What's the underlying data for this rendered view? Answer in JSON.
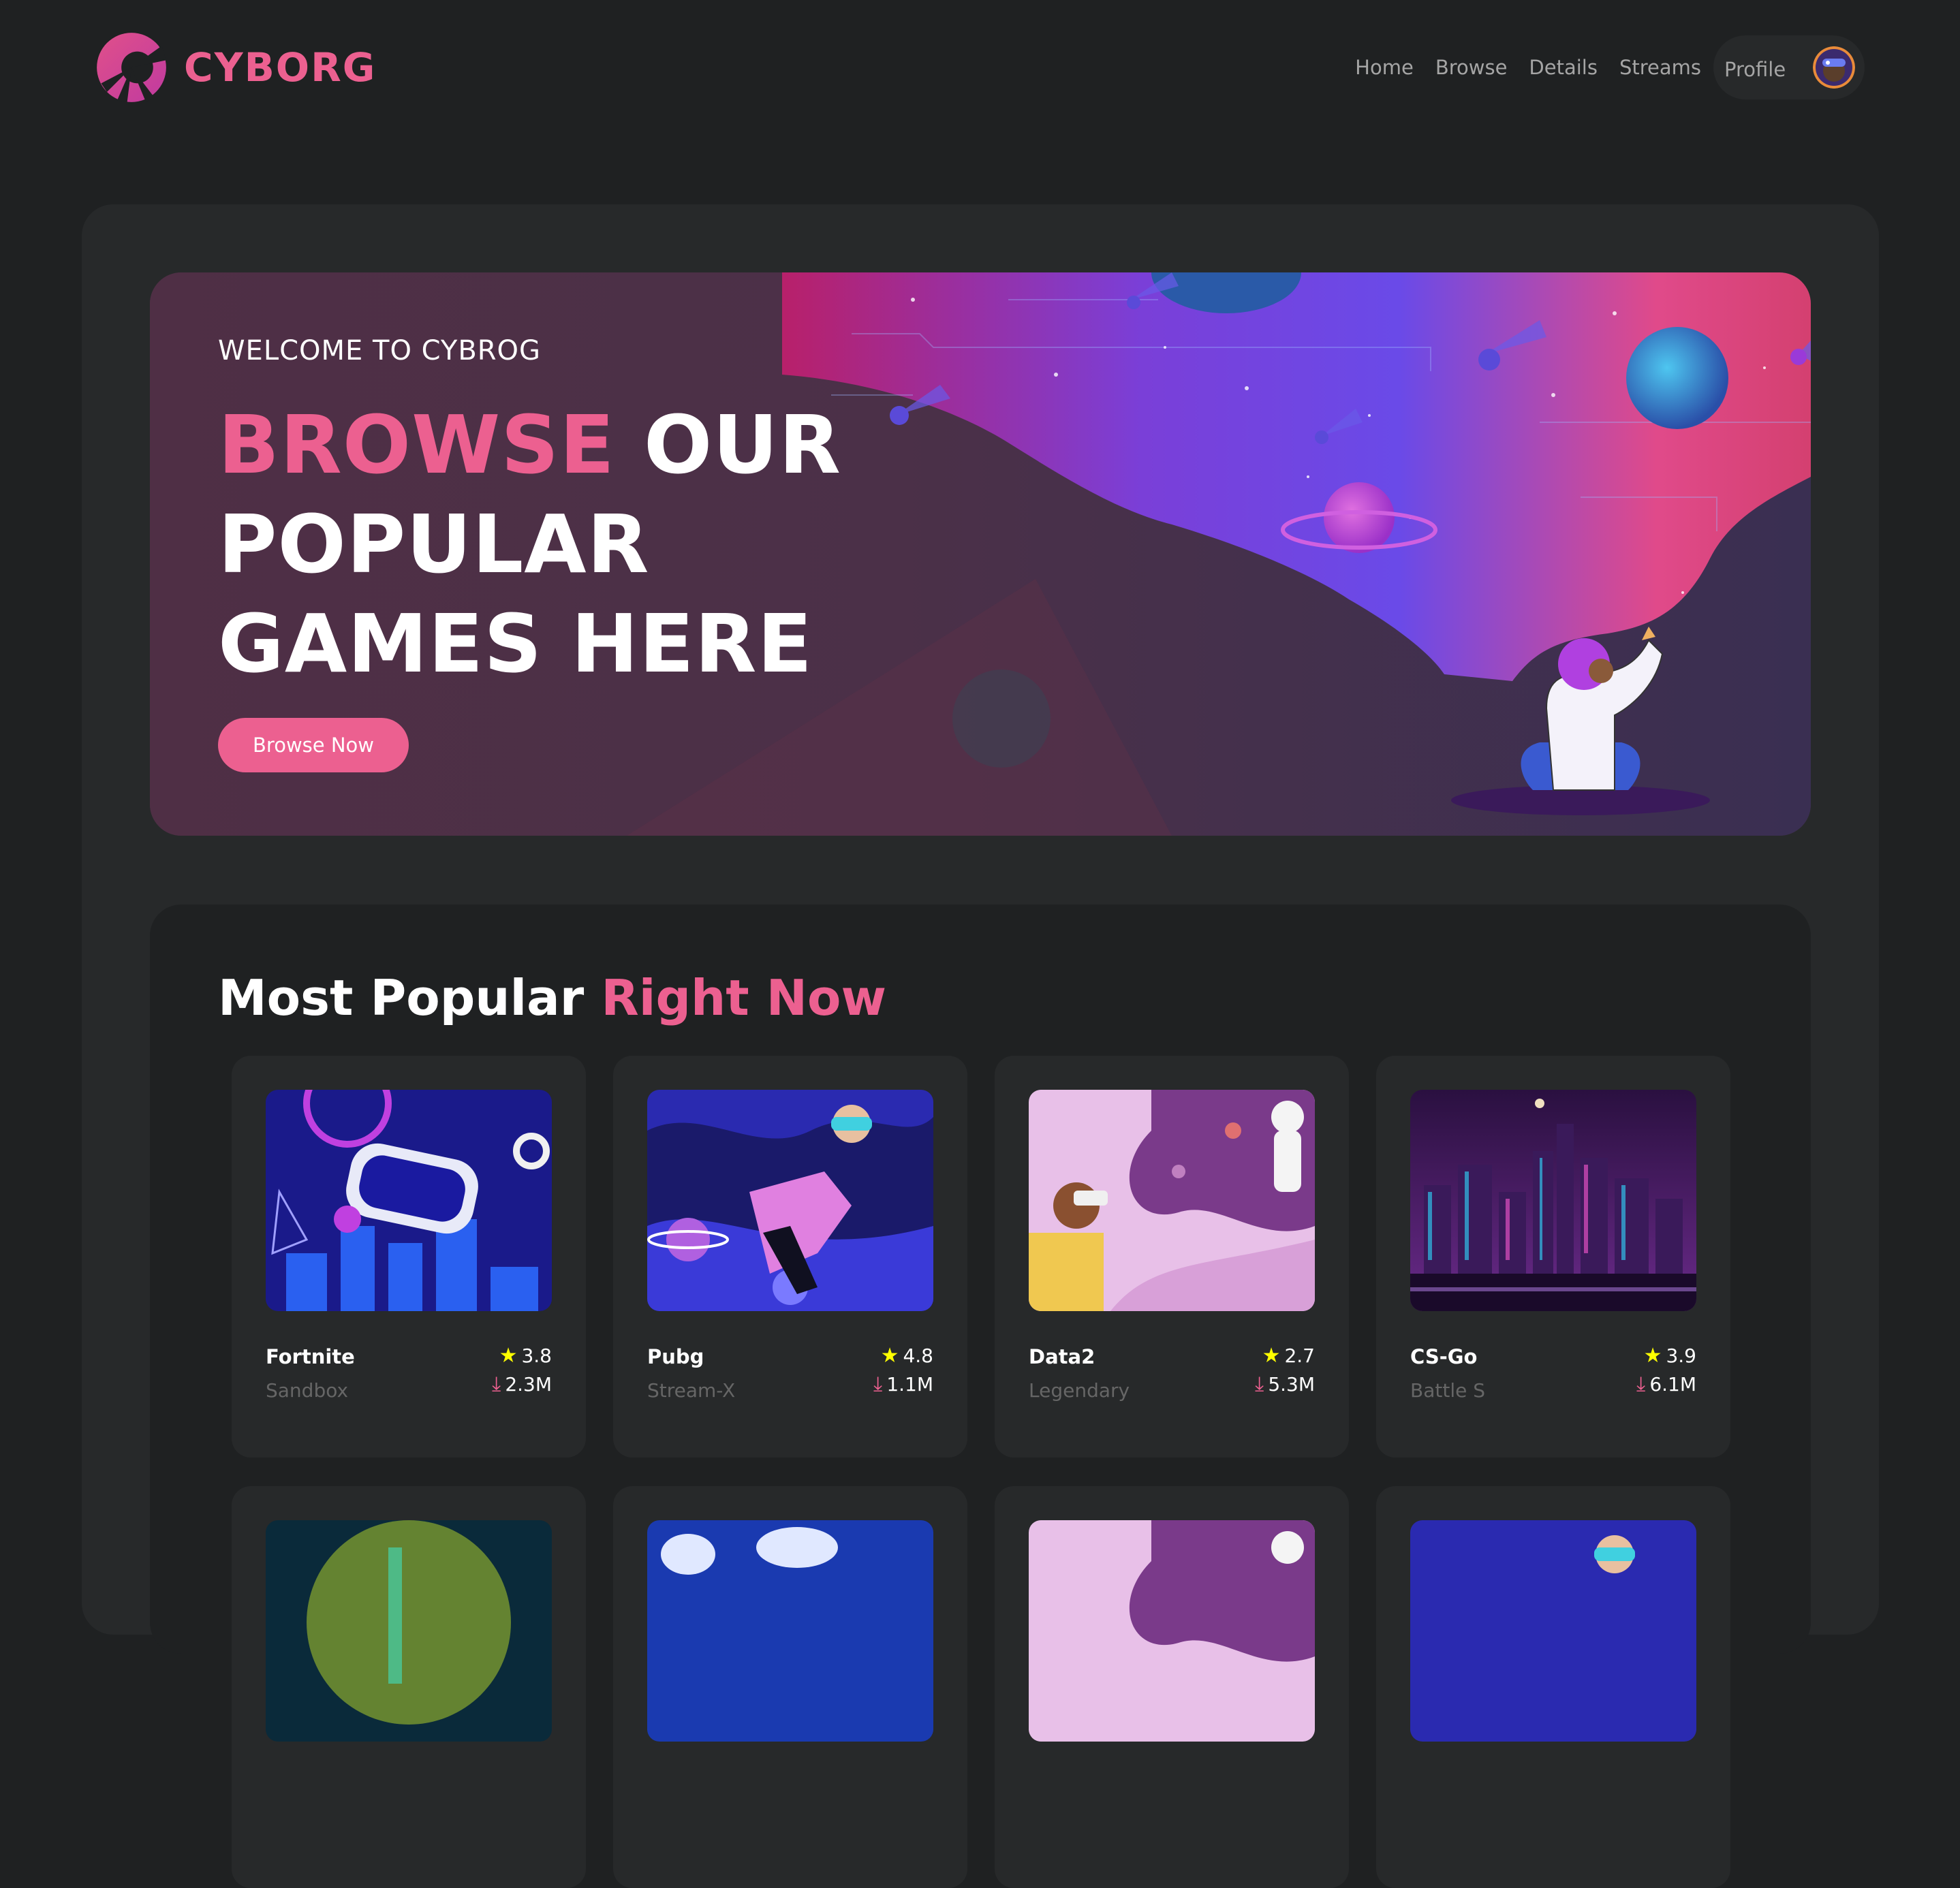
{
  "brand": {
    "name": "CYBORG",
    "accent": "#ec6090"
  },
  "nav": {
    "items": [
      {
        "label": "Home"
      },
      {
        "label": "Browse"
      },
      {
        "label": "Details"
      },
      {
        "label": "Streams"
      }
    ],
    "profile_label": "Profile"
  },
  "banner": {
    "welcome": "WELCOME TO CYBROG",
    "headline_accent": "BROWSE",
    "headline_rest_1": "OUR",
    "headline_rest_2": "POPULAR",
    "headline_rest_3": "GAMES HERE",
    "button_label": "Browse Now"
  },
  "popular": {
    "title_plain": "Most Popular",
    "title_accent": "Right Now",
    "cards": [
      {
        "title": "Fortnite",
        "category": "Sandbox",
        "rating": "3.8",
        "downloads": "2.3M"
      },
      {
        "title": "Pubg",
        "category": "Stream-X",
        "rating": "4.8",
        "downloads": "1.1M"
      },
      {
        "title": "Data2",
        "category": "Legendary",
        "rating": "2.7",
        "downloads": "5.3M"
      },
      {
        "title": "CS-Go",
        "category": "Battle S",
        "rating": "3.9",
        "downloads": "6.1M"
      }
    ]
  },
  "icons": {
    "rating": "star-icon",
    "downloads": "download-icon"
  },
  "colors": {
    "background": "#1f2122",
    "panel": "#27292a",
    "accent": "#ec6090",
    "star": "#ffff00"
  }
}
